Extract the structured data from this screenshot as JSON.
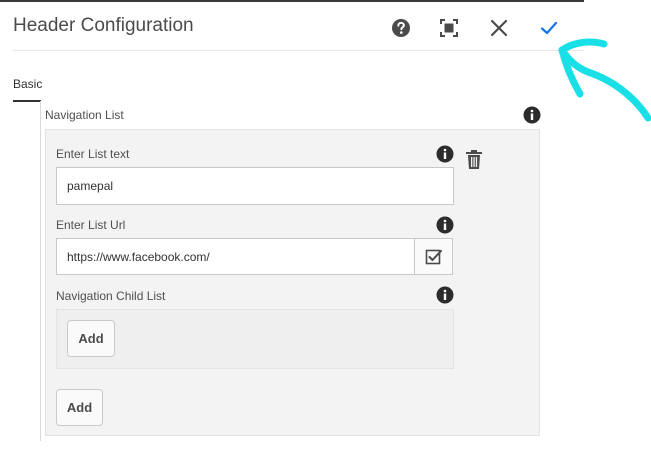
{
  "dialog": {
    "title": "Header Configuration",
    "actions": [
      {
        "name": "help",
        "icon": "help-icon"
      },
      {
        "name": "fullscreen",
        "icon": "fullscreen-icon"
      },
      {
        "name": "cancel",
        "icon": "close-icon"
      },
      {
        "name": "done",
        "icon": "check-icon",
        "color": "#1473e6"
      }
    ]
  },
  "tabs": [
    {
      "label": "Basic",
      "active": true
    }
  ],
  "navigation_list": {
    "label": "Navigation List",
    "item": {
      "list_text": {
        "label": "Enter List text",
        "value": "pamepal"
      },
      "list_url": {
        "label": "Enter List Url",
        "value": "https://www.facebook.com/"
      },
      "child_list": {
        "label": "Navigation Child List",
        "add_label": "Add"
      }
    },
    "add_label": "Add"
  },
  "annotation": {
    "color": "#19e0e6",
    "shape": "arrow pointing to done button"
  }
}
